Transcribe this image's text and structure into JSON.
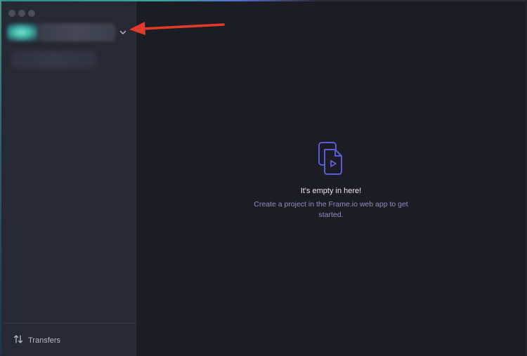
{
  "window": {
    "traffic_lights": [
      "close",
      "minimize",
      "zoom"
    ]
  },
  "sidebar": {
    "account_switcher": {
      "avatar": "blurred",
      "name": "blurred",
      "chevron_icon": "chevron-down-icon"
    },
    "project_item": "blurred",
    "footer": {
      "transfers_icon": "transfer-arrows-icon",
      "transfers_label": "Transfers"
    }
  },
  "main": {
    "empty_state": {
      "icon": "video-files-icon",
      "title": "It's empty in here!",
      "subtitle": "Create a project in the Frame.io web app to get started."
    }
  },
  "annotation": {
    "arrow_color": "#e23a2a"
  },
  "colors": {
    "accent": "#5b5bd6",
    "subtitle": "#8a8fbe",
    "sidebar_bg": "#262833",
    "main_bg": "#1c1d24"
  }
}
